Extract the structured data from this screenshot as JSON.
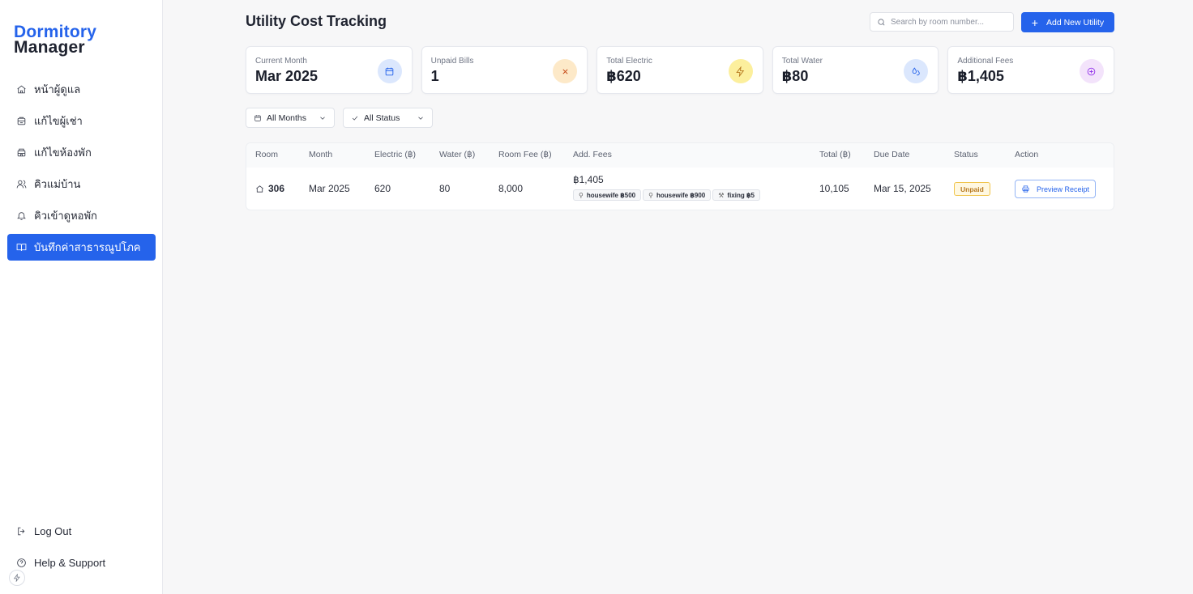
{
  "app": {
    "logo_line1": "Dormitory",
    "logo_line2": "Manager"
  },
  "sidebar": {
    "items": [
      {
        "label": "หน้าผู้ดูแล",
        "icon": "home-icon",
        "active": false
      },
      {
        "label": "แก้ไขผู้เช่า",
        "icon": "users-icon",
        "active": false
      },
      {
        "label": "แก้ไขห้องพัก",
        "icon": "building-icon",
        "active": false
      },
      {
        "label": "คิวแม่บ้าน",
        "icon": "user-group-icon",
        "active": false
      },
      {
        "label": "คิวเข้าดูหอพัก",
        "icon": "bell-icon",
        "active": false
      },
      {
        "label": "บันทึกค่าสาธารณูปโภค",
        "icon": "book-open-icon",
        "active": true
      }
    ],
    "bottom": [
      {
        "label": "Log Out",
        "icon": "logout-icon"
      },
      {
        "label": "Help & Support",
        "icon": "help-circle-icon"
      }
    ]
  },
  "header": {
    "title": "Utility Cost Tracking",
    "search_placeholder": "Search by room number...",
    "add_button": "Add New Utility"
  },
  "cards": [
    {
      "label": "Current Month",
      "value": "Mar 2025",
      "icon": "calendar-icon",
      "color": "#2563eb",
      "bg": "#dbe7fd"
    },
    {
      "label": "Unpaid Bills",
      "value": "1",
      "icon": "x-icon",
      "color": "#c2410c",
      "bg": "#fde9c8"
    },
    {
      "label": "Total Electric",
      "value": "฿620",
      "icon": "lightning-icon",
      "color": "#b7791f",
      "bg": "#fcef9d"
    },
    {
      "label": "Total Water",
      "value": "฿80",
      "icon": "droplets-icon",
      "color": "#2563eb",
      "bg": "#dbe7fd"
    },
    {
      "label": "Additional Fees",
      "value": "฿1,405",
      "icon": "plus-circle-icon",
      "color": "#9333ea",
      "bg": "#f3e3fb"
    }
  ],
  "filters": {
    "month": "All Months",
    "status": "All Status"
  },
  "table": {
    "headers": [
      "Room",
      "Month",
      "Electric (฿)",
      "Water (฿)",
      "Room Fee (฿)",
      "Add. Fees",
      "Total (฿)",
      "Due Date",
      "Status",
      "Action"
    ],
    "rows": [
      {
        "room": "306",
        "month": "Mar 2025",
        "electric": "620",
        "water": "80",
        "room_fee": "8,000",
        "add_fees_total": "฿1,405",
        "fee_tags": [
          {
            "label": "housewife ฿500",
            "icon": "broom-icon"
          },
          {
            "label": "housewife ฿900",
            "icon": "broom-icon"
          },
          {
            "label": "fixing ฿5",
            "icon": "wrench-icon"
          }
        ],
        "total": "10,105",
        "due_date": "Mar 15, 2025",
        "status": "Unpaid",
        "action": "Preview Receipt"
      }
    ]
  }
}
